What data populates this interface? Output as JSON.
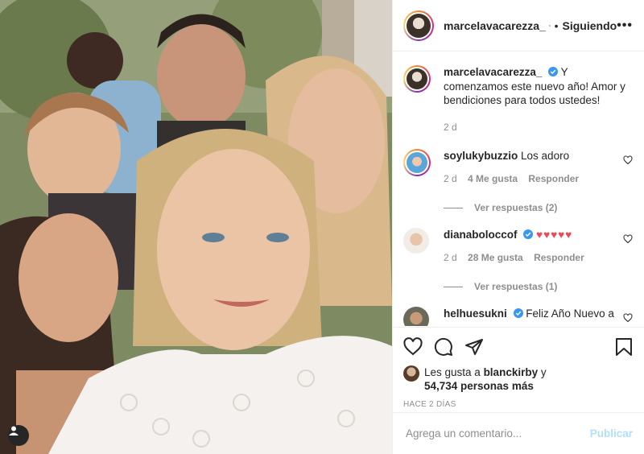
{
  "header": {
    "username": "marcelavacarezza_",
    "separator": "•",
    "follow_status": "Siguiendo",
    "more": "•••"
  },
  "caption": {
    "username": "marcelavacarezza_",
    "text": "Y comenzamos este nuevo año! Amor y bendiciones para todos ustedes!",
    "time": "2 d"
  },
  "comments": [
    {
      "username": "soylukybuzzio",
      "text": "Los adoro",
      "time": "2 d",
      "likes": "4 Me gusta",
      "reply": "Responder",
      "view_replies": "Ver respuestas (2)"
    },
    {
      "username": "dianaboloccof",
      "text": "♥♥♥♥♥",
      "time": "2 d",
      "likes": "28 Me gusta",
      "reply": "Responder",
      "view_replies": "Ver respuestas (1)"
    },
    {
      "username": "helhuesukni",
      "text": "Feliz Año Nuevo a"
    }
  ],
  "likes": {
    "prefix": "Les gusta a ",
    "user": "blanckirby",
    "middle": " y",
    "count": "54,734 personas más"
  },
  "timestamp": "HACE 2 DÍAS",
  "comment_box": {
    "placeholder": "Agrega un comentario...",
    "publish": "Publicar"
  },
  "colors": {
    "verified": "#3897f0",
    "heart_red": "#ed4956",
    "publish_disabled": "#b2dffc",
    "secondary_text": "#8e8e8e"
  },
  "icons": [
    "verified-badge-icon",
    "heart-icon",
    "comment-icon",
    "share-icon",
    "bookmark-icon",
    "user-tag-icon",
    "more-options-icon"
  ]
}
